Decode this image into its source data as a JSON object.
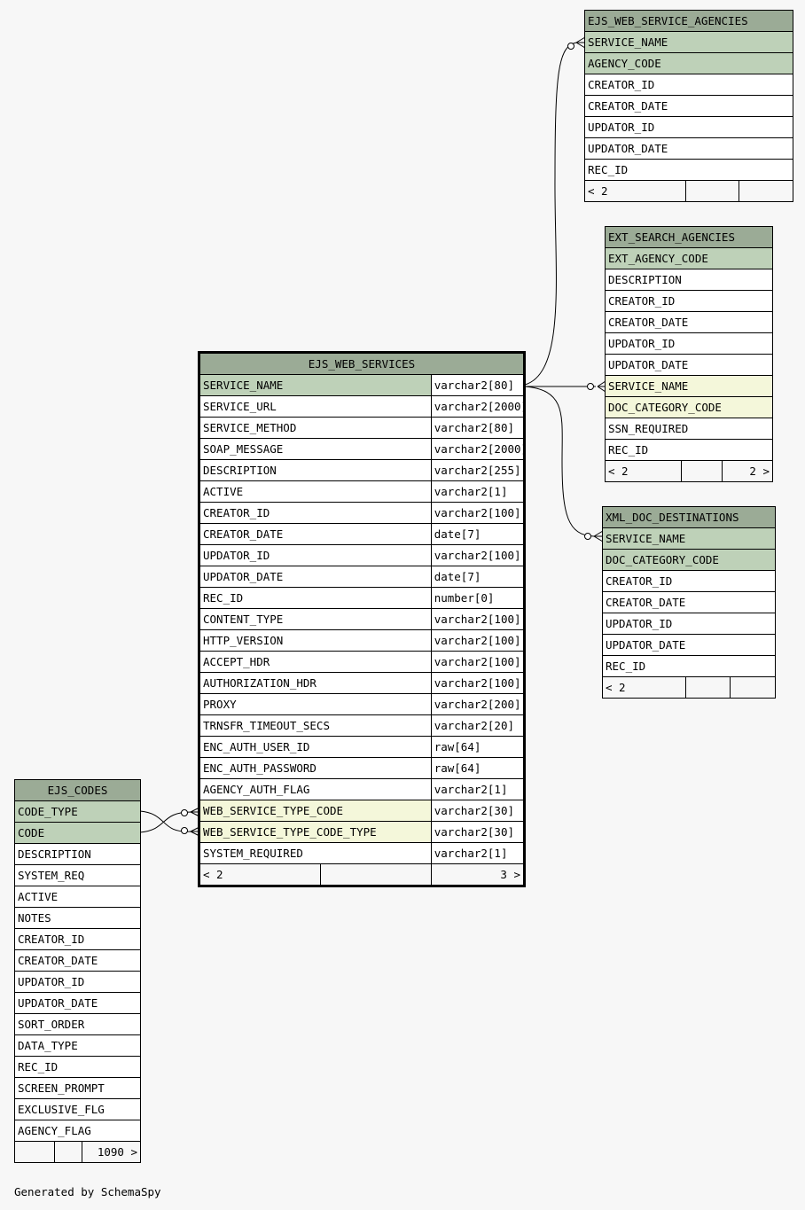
{
  "tables": {
    "ejs_web_service_agencies": {
      "name": "EJS_WEB_SERVICE_AGENCIES",
      "rows": [
        {
          "name": "SERVICE_NAME",
          "kind": "pk"
        },
        {
          "name": "AGENCY_CODE",
          "kind": "pk"
        },
        {
          "name": "CREATOR_ID",
          "kind": ""
        },
        {
          "name": "CREATOR_DATE",
          "kind": ""
        },
        {
          "name": "UPDATOR_ID",
          "kind": ""
        },
        {
          "name": "UPDATOR_DATE",
          "kind": ""
        },
        {
          "name": "REC_ID",
          "kind": ""
        }
      ],
      "footer": [
        "< 2",
        "",
        ""
      ]
    },
    "ext_search_agencies": {
      "name": "EXT_SEARCH_AGENCIES",
      "rows": [
        {
          "name": "EXT_AGENCY_CODE",
          "kind": "pk"
        },
        {
          "name": "DESCRIPTION",
          "kind": ""
        },
        {
          "name": "CREATOR_ID",
          "kind": ""
        },
        {
          "name": "CREATOR_DATE",
          "kind": ""
        },
        {
          "name": "UPDATOR_ID",
          "kind": ""
        },
        {
          "name": "UPDATOR_DATE",
          "kind": ""
        },
        {
          "name": "SERVICE_NAME",
          "kind": "fk"
        },
        {
          "name": "DOC_CATEGORY_CODE",
          "kind": "fk"
        },
        {
          "name": "SSN_REQUIRED",
          "kind": ""
        },
        {
          "name": "REC_ID",
          "kind": ""
        }
      ],
      "footer": [
        "< 2",
        "",
        "2 >"
      ]
    },
    "xml_doc_destinations": {
      "name": "XML_DOC_DESTINATIONS",
      "rows": [
        {
          "name": "SERVICE_NAME",
          "kind": "pk"
        },
        {
          "name": "DOC_CATEGORY_CODE",
          "kind": "pk"
        },
        {
          "name": "CREATOR_ID",
          "kind": ""
        },
        {
          "name": "CREATOR_DATE",
          "kind": ""
        },
        {
          "name": "UPDATOR_ID",
          "kind": ""
        },
        {
          "name": "UPDATOR_DATE",
          "kind": ""
        },
        {
          "name": "REC_ID",
          "kind": ""
        }
      ],
      "footer": [
        "< 2",
        "",
        ""
      ]
    },
    "ejs_web_services": {
      "name": "EJS_WEB_SERVICES",
      "rows": [
        {
          "name": "SERVICE_NAME",
          "type": "varchar2[80]",
          "kind": "pk"
        },
        {
          "name": "SERVICE_URL",
          "type": "varchar2[2000]",
          "kind": ""
        },
        {
          "name": "SERVICE_METHOD",
          "type": "varchar2[80]",
          "kind": ""
        },
        {
          "name": "SOAP_MESSAGE",
          "type": "varchar2[2000]",
          "kind": ""
        },
        {
          "name": "DESCRIPTION",
          "type": "varchar2[255]",
          "kind": ""
        },
        {
          "name": "ACTIVE",
          "type": "varchar2[1]",
          "kind": ""
        },
        {
          "name": "CREATOR_ID",
          "type": "varchar2[100]",
          "kind": ""
        },
        {
          "name": "CREATOR_DATE",
          "type": "date[7]",
          "kind": ""
        },
        {
          "name": "UPDATOR_ID",
          "type": "varchar2[100]",
          "kind": ""
        },
        {
          "name": "UPDATOR_DATE",
          "type": "date[7]",
          "kind": ""
        },
        {
          "name": "REC_ID",
          "type": "number[0]",
          "kind": ""
        },
        {
          "name": "CONTENT_TYPE",
          "type": "varchar2[100]",
          "kind": ""
        },
        {
          "name": "HTTP_VERSION",
          "type": "varchar2[100]",
          "kind": ""
        },
        {
          "name": "ACCEPT_HDR",
          "type": "varchar2[100]",
          "kind": ""
        },
        {
          "name": "AUTHORIZATION_HDR",
          "type": "varchar2[100]",
          "kind": ""
        },
        {
          "name": "PROXY",
          "type": "varchar2[200]",
          "kind": ""
        },
        {
          "name": "TRNSFR_TIMEOUT_SECS",
          "type": "varchar2[20]",
          "kind": ""
        },
        {
          "name": "ENC_AUTH_USER_ID",
          "type": "raw[64]",
          "kind": ""
        },
        {
          "name": "ENC_AUTH_PASSWORD",
          "type": "raw[64]",
          "kind": ""
        },
        {
          "name": "AGENCY_AUTH_FLAG",
          "type": "varchar2[1]",
          "kind": ""
        },
        {
          "name": "WEB_SERVICE_TYPE_CODE",
          "type": "varchar2[30]",
          "kind": "fk"
        },
        {
          "name": "WEB_SERVICE_TYPE_CODE_TYPE",
          "type": "varchar2[30]",
          "kind": "fk"
        },
        {
          "name": "SYSTEM_REQUIRED",
          "type": "varchar2[1]",
          "kind": ""
        }
      ],
      "footer": [
        "< 2",
        "",
        "3 >"
      ]
    },
    "ejs_codes": {
      "name": "EJS_CODES",
      "rows": [
        {
          "name": "CODE_TYPE",
          "kind": "pk"
        },
        {
          "name": "CODE",
          "kind": "pk"
        },
        {
          "name": "DESCRIPTION",
          "kind": ""
        },
        {
          "name": "SYSTEM_REQ",
          "kind": ""
        },
        {
          "name": "ACTIVE",
          "kind": ""
        },
        {
          "name": "NOTES",
          "kind": ""
        },
        {
          "name": "CREATOR_ID",
          "kind": ""
        },
        {
          "name": "CREATOR_DATE",
          "kind": ""
        },
        {
          "name": "UPDATOR_ID",
          "kind": ""
        },
        {
          "name": "UPDATOR_DATE",
          "kind": ""
        },
        {
          "name": "SORT_ORDER",
          "kind": ""
        },
        {
          "name": "DATA_TYPE",
          "kind": ""
        },
        {
          "name": "REC_ID",
          "kind": ""
        },
        {
          "name": "SCREEN_PROMPT",
          "kind": ""
        },
        {
          "name": "EXCLUSIVE_FLG",
          "kind": ""
        },
        {
          "name": "AGENCY_FLAG",
          "kind": ""
        }
      ],
      "footer": [
        "",
        "",
        "1090 >"
      ]
    }
  },
  "footer_text": "Generated by SchemaSpy",
  "colors": {
    "background": "#f7f7f7",
    "header": "#9bab96",
    "primary_key": "#bed1b8",
    "foreign_key": "#f4f7da",
    "row": "#ffffff"
  }
}
